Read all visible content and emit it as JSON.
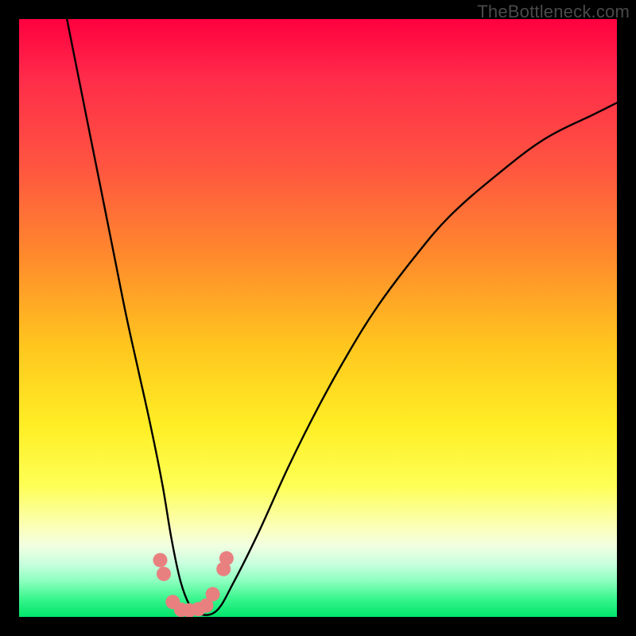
{
  "watermark": "TheBottleneck.com",
  "chart_data": {
    "type": "line",
    "title": "",
    "xlabel": "",
    "ylabel": "",
    "xlim": [
      0,
      100
    ],
    "ylim": [
      0,
      100
    ],
    "grid": false,
    "legend": false,
    "series": [
      {
        "name": "curve",
        "x": [
          8,
          10,
          12,
          14,
          16,
          18,
          20,
          22,
          24,
          25.5,
          27,
          28.5,
          30,
          33,
          36,
          40,
          45,
          50,
          55,
          60,
          66,
          72,
          80,
          88,
          96,
          100
        ],
        "y": [
          100,
          90,
          80,
          70,
          60,
          50,
          41,
          32,
          22,
          13,
          6,
          2,
          0.5,
          1,
          6,
          14,
          25,
          35,
          44,
          52,
          60,
          67,
          74,
          80,
          84,
          86
        ]
      }
    ],
    "markers": {
      "name": "dots",
      "points": [
        {
          "x": 23.6,
          "y": 9.5
        },
        {
          "x": 24.2,
          "y": 7.2
        },
        {
          "x": 25.7,
          "y": 2.5
        },
        {
          "x": 27.1,
          "y": 1.2
        },
        {
          "x": 28.5,
          "y": 1.1
        },
        {
          "x": 30.0,
          "y": 1.3
        },
        {
          "x": 31.3,
          "y": 1.9
        },
        {
          "x": 32.4,
          "y": 3.8
        },
        {
          "x": 34.2,
          "y": 8.0
        },
        {
          "x": 34.7,
          "y": 9.8
        }
      ]
    },
    "color_bands": [
      {
        "color": "#ff003f",
        "y": 100
      },
      {
        "color": "#ff8b2c",
        "y": 60
      },
      {
        "color": "#ffee25",
        "y": 30
      },
      {
        "color": "#00e56b",
        "y": 0
      }
    ]
  }
}
